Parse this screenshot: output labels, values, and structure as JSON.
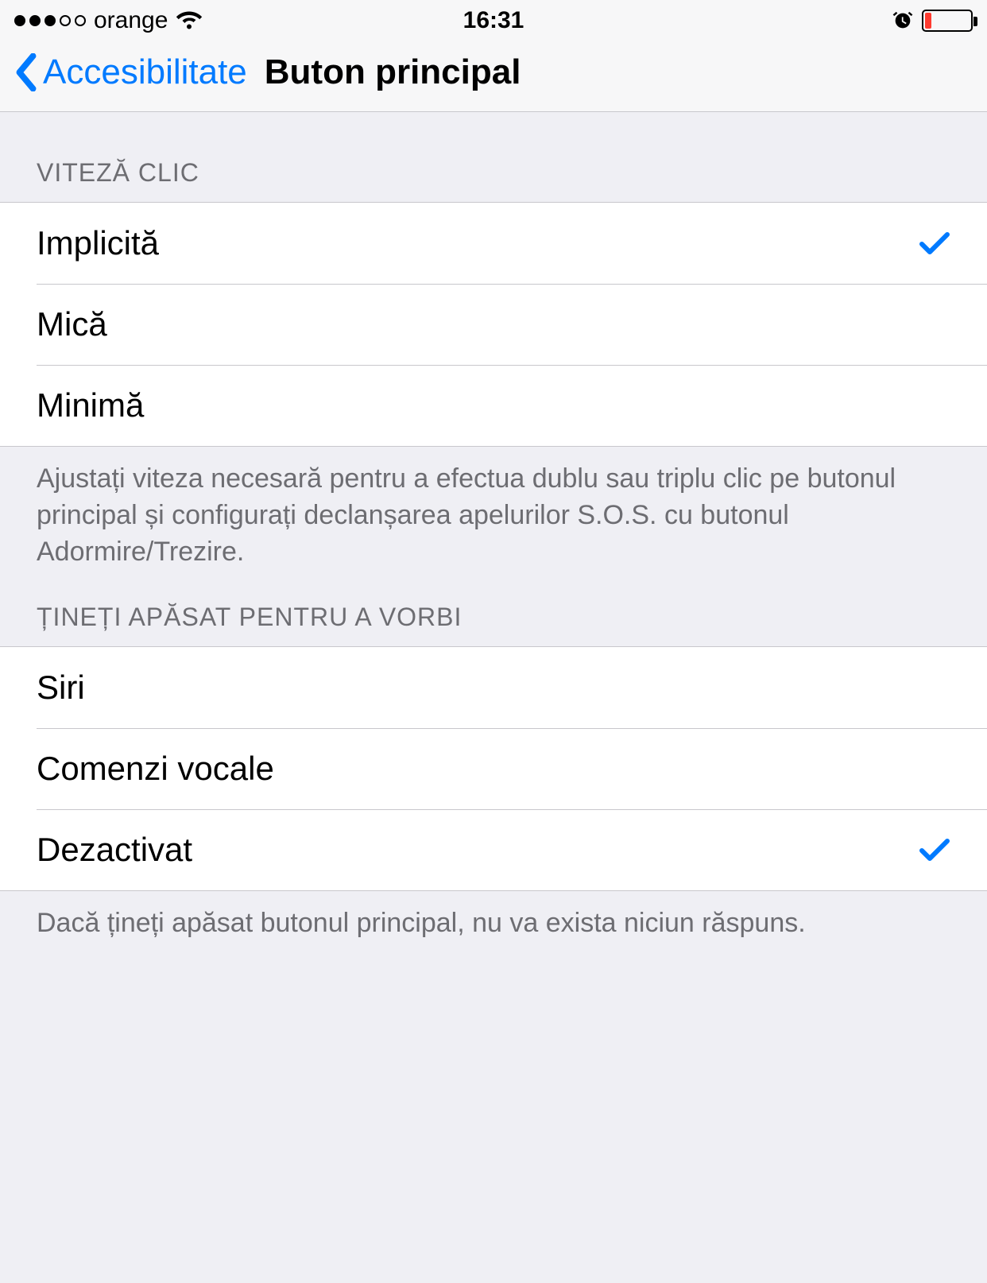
{
  "statusbar": {
    "carrier": "orange",
    "time": "16:31"
  },
  "navbar": {
    "back_label": "Accesibilitate",
    "title": "Buton principal"
  },
  "sections": {
    "click_speed": {
      "header": "VITEZĂ CLIC",
      "options": {
        "default": "Implicită",
        "slow": "Mică",
        "slowest": "Minimă"
      },
      "footer": "Ajustați viteza necesară pentru a efectua dublu sau triplu clic pe butonul principal și configurați declanșarea apelurilor S.O.S. cu butonul Adormire/Trezire."
    },
    "press_hold": {
      "header": "ȚINEȚI APĂSAT PENTRU A VORBI",
      "options": {
        "siri": "Siri",
        "voice": "Comenzi vocale",
        "off": "Dezactivat"
      },
      "footer": "Dacă țineți apăsat butonul principal, nu va exista niciun răspuns."
    }
  }
}
